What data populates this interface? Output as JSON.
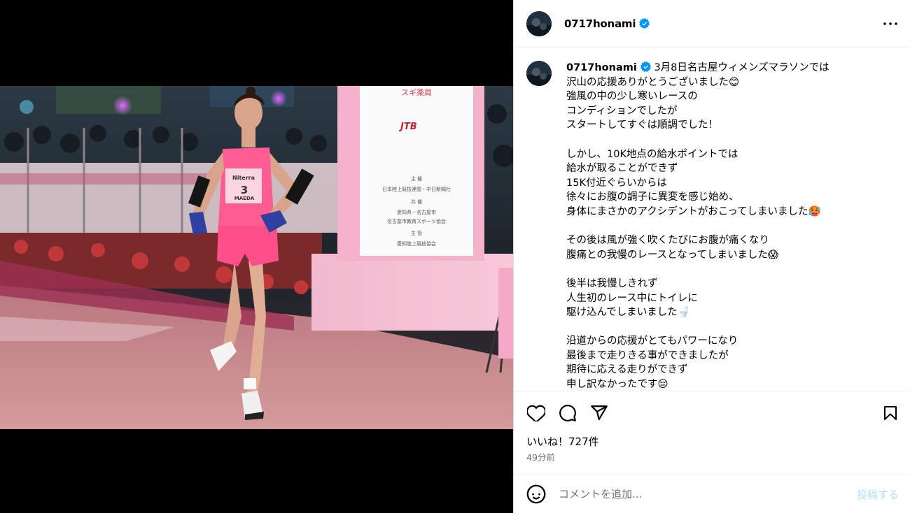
{
  "post": {
    "username": "0717honami",
    "caption_lines": [
      "3月8日名古屋ウィメンズマラソンでは",
      "沢山の応援ありがとうございました😊",
      "強風の中の少し寒いレースの",
      "コンディションでしたが",
      "スタートしてすぐは順調でした！",
      "",
      "しかし、10K地点の給水ポイントでは",
      "給水が取ることができず",
      "15K付近ぐらいからは",
      "徐々にお腹の調子に異変を感じ始め、",
      "身体にまさかのアクシデントがおこってしまいました🥵",
      "",
      "その後は風が強く吹くたびにお腹が痛くなり",
      "腹痛との我慢のレースとなってしまいました😱",
      "",
      "後半は我慢しきれず",
      "人生初のレース中にトイレに",
      "駆け込んでしまいました🚽",
      "",
      "沿道からの応援がとてもパワーになり",
      "最後まで走りきる事ができましたが",
      "期待に応える走りができず",
      "申し訳なかったです😔"
    ],
    "likes": "いいね！727件",
    "time_ago": "49分前"
  },
  "photo": {
    "bib_number": "3",
    "bib_name": "MAEDA",
    "bib_sponsor": "Niterra",
    "sign_brand": "スギ薬局",
    "sign_jtb": "JTB",
    "sign_lines": [
      "主 催",
      "日本陸上競技連盟・中日新聞社",
      "共 催",
      "愛知県・名古屋市",
      "名古屋市教育スポーツ協会",
      "主 管",
      "愛知陸上競技協会"
    ]
  },
  "comment": {
    "placeholder": "コメントを追加...",
    "post_label": "投稿する"
  },
  "colors": {
    "verified": "#0095f6",
    "post_button": "#b2dffc",
    "meta_text": "#737373"
  },
  "icons": [
    "more-options-icon",
    "verified-badge-icon",
    "heart-icon",
    "comment-icon",
    "share-icon",
    "bookmark-icon",
    "emoji-icon"
  ]
}
